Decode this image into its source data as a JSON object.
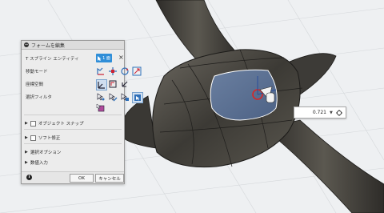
{
  "panel": {
    "title": "フォームを編集",
    "rows": {
      "entity_label": "T スプライン エンティティ",
      "move_mode_label": "移動モード",
      "coord_label": "座標空間",
      "filter_label": "選択フィルタ"
    },
    "entity_button_label": "1 面",
    "object_snap_label": "オブジェクト スナップ",
    "soft_modify_label": "ソフト修正",
    "selection_options_label": "選択オプション",
    "numeric_input_label": "数値入力",
    "ok_label": "OK",
    "cancel_label": "キャンセル"
  },
  "value_field": {
    "value": "0.721"
  },
  "colors": {
    "accent": "#2f8ed8",
    "model_body": "#4a4741",
    "selected_face": "#5a6f8e"
  }
}
